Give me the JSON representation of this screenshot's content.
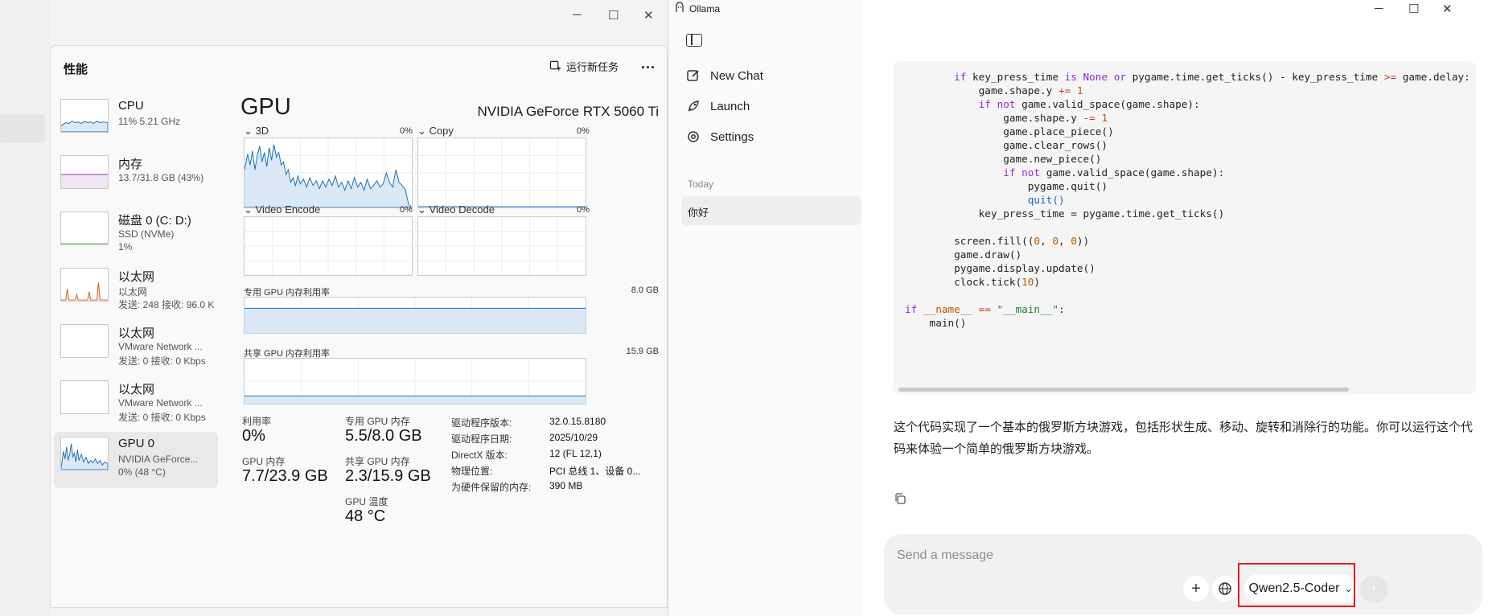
{
  "task_manager": {
    "title": "性能",
    "run_new_task": "运行新任务",
    "more": "...",
    "resources": [
      {
        "name": "CPU",
        "line1": "11% 5.21 GHz",
        "line2": ""
      },
      {
        "name": "内存",
        "line1": "13.7/31.8 GB (43%)",
        "line2": ""
      },
      {
        "name": "磁盘 0 (C: D:)",
        "line1": "SSD (NVMe)",
        "line2": "1%"
      },
      {
        "name": "以太网",
        "line1": "以太网",
        "line2": "发送: 248 接收: 96.0 K"
      },
      {
        "name": "以太网",
        "line1": "VMware Network ...",
        "line2": "发送: 0 接收: 0 Kbps"
      },
      {
        "name": "以太网",
        "line1": "VMware Network ...",
        "line2": "发送: 0 接收: 0 Kbps"
      },
      {
        "name": "GPU 0",
        "line1": "NVIDIA GeForce...",
        "line2": "0% (48 °C)"
      }
    ],
    "gpu": {
      "title": "GPU",
      "model": "NVIDIA GeForce RTX 5060 Ti",
      "engines": [
        {
          "name": "3D",
          "pct": "0%"
        },
        {
          "name": "Copy",
          "pct": "0%"
        },
        {
          "name": "Video Encode",
          "pct": "0%"
        },
        {
          "name": "Video Decode",
          "pct": "0%"
        }
      ],
      "dedicated_label": "专用 GPU 内存利用率",
      "dedicated_max": "8.0 GB",
      "shared_label": "共享 GPU 内存利用率",
      "shared_max": "15.9 GB",
      "stats": {
        "utilization_label": "利用率",
        "utilization": "0%",
        "dedicated_mem_label": "专用 GPU 内存",
        "dedicated_mem": "5.5/8.0 GB",
        "gpu_mem_label": "GPU 内存",
        "gpu_mem": "7.7/23.9 GB",
        "shared_mem_label": "共享 GPU 内存",
        "shared_mem": "2.3/15.9 GB",
        "temp_label": "GPU 温度",
        "temp": "48 °C"
      },
      "details": [
        {
          "k": "驱动程序版本:",
          "v": "32.0.15.8180"
        },
        {
          "k": "驱动程序日期:",
          "v": "2025/10/29"
        },
        {
          "k": "DirectX 版本:",
          "v": "12 (FL 12.1)"
        },
        {
          "k": "物理位置:",
          "v": "PCI 总线 1、设备 0..."
        },
        {
          "k": "为硬件保留的内存:",
          "v": "390 MB"
        }
      ]
    }
  },
  "ollama": {
    "app_title": "Ollama",
    "nav": {
      "new_chat": "New Chat",
      "launch": "Launch",
      "settings": "Settings"
    },
    "today": "Today",
    "chat_item": "你好",
    "answer": "这个代码实现了一个基本的俄罗斯方块游戏，包括形状生成、移动、旋转和消除行的功能。你可以运行这个代码来体验一个简单的俄罗斯方块游戏。",
    "input_placeholder": "Send a message",
    "model": "Qwen2.5-Coder",
    "code_lines": [
      "        if key_press_time is None or pygame.time.get_ticks() - key_press_time >= game.delay:",
      "            game.shape.y += 1",
      "            if not game.valid_space(game.shape):",
      "                game.shape.y -= 1",
      "                game.place_piece()",
      "                game.clear_rows()",
      "                game.new_piece()",
      "                if not game.valid_space(game.shape):",
      "                    pygame.quit()",
      "                    quit()",
      "            key_press_time = pygame.time.get_ticks()",
      "",
      "        screen.fill((0, 0, 0))",
      "        game.draw()",
      "        pygame.display.update()",
      "        clock.tick(10)",
      "",
      "if __name__ == \"__main__\":",
      "    main()"
    ]
  },
  "colors": {
    "accent": "#0078d4",
    "highlight": "#e02020"
  }
}
